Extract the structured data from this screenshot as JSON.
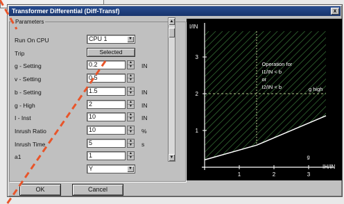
{
  "dialog": {
    "title": "Transformer Differential (Diff-Transf)",
    "close_label": "x",
    "group_label": "Parameters"
  },
  "params": [
    {
      "label": "Run On CPU",
      "value": "CPU 1",
      "kind": "dropdown",
      "unit": ""
    },
    {
      "label": "Trip",
      "value": "Selected",
      "kind": "button",
      "unit": ""
    },
    {
      "label": "g - Setting",
      "value": "0.2",
      "kind": "spin",
      "unit": "IN"
    },
    {
      "label": "v - Setting",
      "value": "0.5",
      "kind": "spin",
      "unit": ""
    },
    {
      "label": "b - Setting",
      "value": "1.5",
      "kind": "spin",
      "unit": "IN"
    },
    {
      "label": "g - High",
      "value": "2",
      "kind": "spin",
      "unit": "IN"
    },
    {
      "label": "I - Inst",
      "value": "10",
      "kind": "spin",
      "unit": "IN"
    },
    {
      "label": "Inrush Ratio",
      "value": "10",
      "kind": "spin",
      "unit": "%"
    },
    {
      "label": "Inrush Time",
      "value": "5",
      "kind": "spin",
      "unit": "s"
    },
    {
      "label": "a1",
      "value": "1",
      "kind": "spin",
      "unit": ""
    },
    {
      "label": "",
      "value": "Y",
      "kind": "dropdown",
      "unit": ""
    }
  ],
  "buttons": {
    "ok": "OK",
    "cancel": "Cancel"
  },
  "icons": {
    "close": "close-icon",
    "dropdown": "chevron-down-icon",
    "spin_up": "arrow-up-icon",
    "spin_down": "arrow-down-icon"
  },
  "colors": {
    "chart_bg": "#000000",
    "curve": "#ffffff",
    "hatch": "#3a7a3a",
    "guide": "#b8c890"
  },
  "chart_data": {
    "type": "line",
    "ylabel": "I/IN",
    "xlabel": "IH/IN",
    "xlim": [
      0,
      3.5
    ],
    "ylim": [
      0,
      3.7
    ],
    "xticks": [
      "1",
      "2",
      "3"
    ],
    "yticks": [
      "1",
      "2",
      "3"
    ],
    "series": [
      {
        "x": [
          0,
          1.5,
          3.5
        ],
        "y": [
          0.2,
          0.6,
          1.4
        ]
      }
    ],
    "annotations": {
      "operation_text": [
        "Operation for",
        "I1/IN < b",
        "or",
        "I2/IN < b"
      ],
      "g_high_label": "g high",
      "g_high_value": 2,
      "g_label": "g",
      "v_marker": 1.5
    }
  }
}
